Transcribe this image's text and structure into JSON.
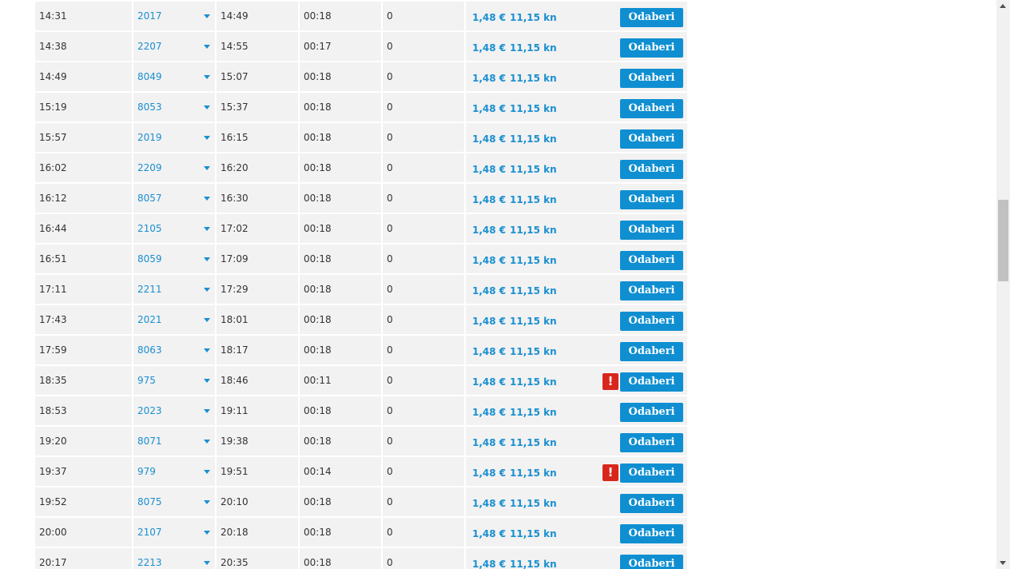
{
  "currency": {
    "eur": "1,48 €",
    "kn": "11,15 kn"
  },
  "button_label": "Odaberi",
  "warning_glyph": "!",
  "rows": [
    {
      "dep": "14:31",
      "train": "2017",
      "arr": "14:49",
      "dur": "00:18",
      "changes": "0",
      "warning": false
    },
    {
      "dep": "14:38",
      "train": "2207",
      "arr": "14:55",
      "dur": "00:17",
      "changes": "0",
      "warning": false
    },
    {
      "dep": "14:49",
      "train": "8049",
      "arr": "15:07",
      "dur": "00:18",
      "changes": "0",
      "warning": false
    },
    {
      "dep": "15:19",
      "train": "8053",
      "arr": "15:37",
      "dur": "00:18",
      "changes": "0",
      "warning": false
    },
    {
      "dep": "15:57",
      "train": "2019",
      "arr": "16:15",
      "dur": "00:18",
      "changes": "0",
      "warning": false
    },
    {
      "dep": "16:02",
      "train": "2209",
      "arr": "16:20",
      "dur": "00:18",
      "changes": "0",
      "warning": false
    },
    {
      "dep": "16:12",
      "train": "8057",
      "arr": "16:30",
      "dur": "00:18",
      "changes": "0",
      "warning": false
    },
    {
      "dep": "16:44",
      "train": "2105",
      "arr": "17:02",
      "dur": "00:18",
      "changes": "0",
      "warning": false
    },
    {
      "dep": "16:51",
      "train": "8059",
      "arr": "17:09",
      "dur": "00:18",
      "changes": "0",
      "warning": false
    },
    {
      "dep": "17:11",
      "train": "2211",
      "arr": "17:29",
      "dur": "00:18",
      "changes": "0",
      "warning": false
    },
    {
      "dep": "17:43",
      "train": "2021",
      "arr": "18:01",
      "dur": "00:18",
      "changes": "0",
      "warning": false
    },
    {
      "dep": "17:59",
      "train": "8063",
      "arr": "18:17",
      "dur": "00:18",
      "changes": "0",
      "warning": false
    },
    {
      "dep": "18:35",
      "train": "975",
      "arr": "18:46",
      "dur": "00:11",
      "changes": "0",
      "warning": true
    },
    {
      "dep": "18:53",
      "train": "2023",
      "arr": "19:11",
      "dur": "00:18",
      "changes": "0",
      "warning": false
    },
    {
      "dep": "19:20",
      "train": "8071",
      "arr": "19:38",
      "dur": "00:18",
      "changes": "0",
      "warning": false
    },
    {
      "dep": "19:37",
      "train": "979",
      "arr": "19:51",
      "dur": "00:14",
      "changes": "0",
      "warning": true
    },
    {
      "dep": "19:52",
      "train": "8075",
      "arr": "20:10",
      "dur": "00:18",
      "changes": "0",
      "warning": false
    },
    {
      "dep": "20:00",
      "train": "2107",
      "arr": "20:18",
      "dur": "00:18",
      "changes": "0",
      "warning": false
    },
    {
      "dep": "20:17",
      "train": "2213",
      "arr": "20:35",
      "dur": "00:18",
      "changes": "0",
      "warning": false
    }
  ],
  "colors": {
    "link": "#1a8fd0",
    "button": "#0f8fd1",
    "warning": "#d9261c",
    "row_bg": "#f2f2f2"
  }
}
